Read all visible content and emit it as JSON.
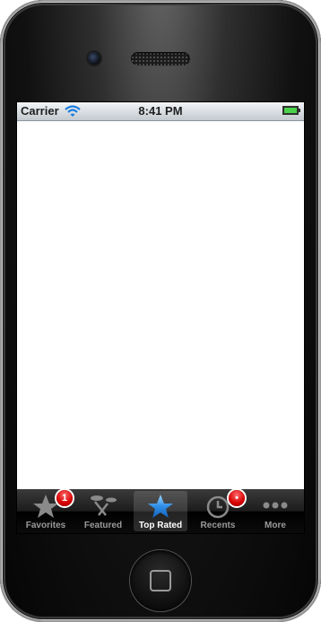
{
  "status_bar": {
    "carrier": "Carrier",
    "time": "8:41 PM",
    "icons": [
      "wifi-icon",
      "battery-icon"
    ]
  },
  "tab_bar": {
    "selected_index": 2,
    "tabs": [
      {
        "label": "Favorites",
        "icon": "star-icon",
        "badge": "1"
      },
      {
        "label": "Featured",
        "icon": "featured-icon",
        "badge": ""
      },
      {
        "label": "Top Rated",
        "icon": "star-icon",
        "badge": ""
      },
      {
        "label": "Recents",
        "icon": "clock-icon",
        "badge": "•"
      },
      {
        "label": "More",
        "icon": "more-icon",
        "badge": ""
      }
    ]
  },
  "colors": {
    "accent_selected": "#2f8fe8",
    "badge": "#d60000",
    "tab_inactive": "#8a8a8a"
  }
}
